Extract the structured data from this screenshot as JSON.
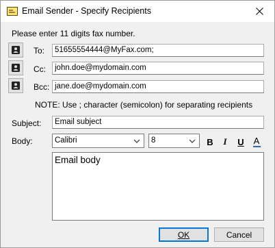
{
  "window": {
    "title": "Email Sender - Specify Recipients"
  },
  "instruction": "Please enter 11 digits fax number.",
  "recipients": {
    "to": {
      "label": "To:",
      "value": "51655554444@MyFax.com;"
    },
    "cc": {
      "label": "Cc:",
      "value": "john.doe@mydomain.com"
    },
    "bcc": {
      "label": "Bcc:",
      "value": "jane.doe@mydomain.com"
    }
  },
  "note": "NOTE: Use ; character (semicolon) for separating recipients",
  "subject": {
    "label": "Subject:",
    "value": "Email subject"
  },
  "body": {
    "label": "Body:",
    "font": "Calibri",
    "size": "8",
    "bold_label": "B",
    "italic_label": "I",
    "underline_label": "U",
    "color_label": "A",
    "text": "Email body"
  },
  "buttons": {
    "ok": "OK",
    "cancel": "Cancel"
  },
  "colors": {
    "accent": "#0078d7",
    "font_color_bar": "#2b6cb0"
  }
}
